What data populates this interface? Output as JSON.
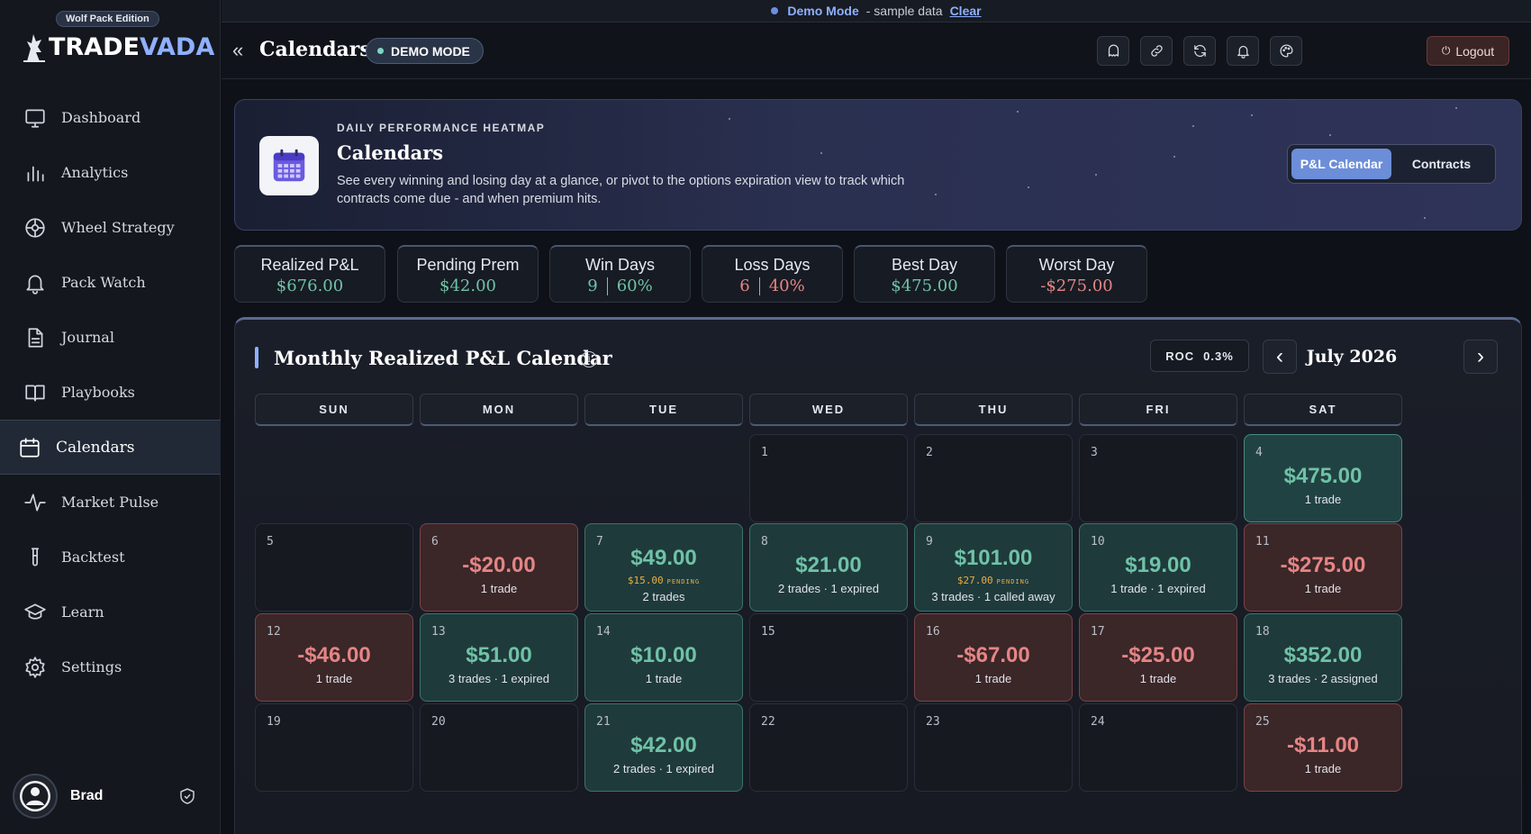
{
  "sidebar": {
    "edition": "Wolf Pack Edition",
    "brand_a": "TRADE",
    "brand_b": "VADA",
    "items": [
      {
        "label": "Dashboard",
        "icon": "monitor-icon"
      },
      {
        "label": "Analytics",
        "icon": "bar-chart-icon"
      },
      {
        "label": "Wheel Strategy",
        "icon": "wheel-icon"
      },
      {
        "label": "Pack Watch",
        "icon": "bell-icon"
      },
      {
        "label": "Journal",
        "icon": "document-icon"
      },
      {
        "label": "Playbooks",
        "icon": "book-icon"
      },
      {
        "label": "Calendars",
        "icon": "calendar-icon"
      },
      {
        "label": "Market Pulse",
        "icon": "pulse-icon"
      },
      {
        "label": "Backtest",
        "icon": "test-tube-icon"
      },
      {
        "label": "Learn",
        "icon": "graduation-cap-icon"
      },
      {
        "label": "Settings",
        "icon": "gear-icon"
      }
    ],
    "user": "Brad"
  },
  "demo_strip": {
    "mode": "Demo Mode",
    "sample": "- sample data",
    "clear": "Clear"
  },
  "header": {
    "title": "Calendars",
    "pill": "DEMO MODE",
    "logout": "Logout"
  },
  "hero": {
    "kicker": "DAILY PERFORMANCE HEATMAP",
    "title": "Calendars",
    "desc": "See every winning and losing day at a glance, or pivot to the options expiration view to track which contracts come due - and when premium hits.",
    "toggle": [
      "P&L Calendar",
      "Contracts"
    ]
  },
  "stats": [
    {
      "label": "Realized P&L",
      "value": "$676.00",
      "tone": "green"
    },
    {
      "label": "Pending Prem",
      "value": "$42.00",
      "tone": "green"
    },
    {
      "label": "Win Days",
      "count": "9",
      "pct": "60%",
      "tone": "green"
    },
    {
      "label": "Loss Days",
      "count": "6",
      "pct": "40%",
      "tone": "red"
    },
    {
      "label": "Best Day",
      "value": "$475.00",
      "tone": "green"
    },
    {
      "label": "Worst Day",
      "value": "-$275.00",
      "tone": "red"
    }
  ],
  "calendar": {
    "title": "Monthly Realized P&L Calendar",
    "roc_label": "ROC",
    "roc_value": "0.3%",
    "month": "July 2026",
    "weekdays": [
      "SUN",
      "MON",
      "TUE",
      "WED",
      "THU",
      "FRI",
      "SAT"
    ],
    "pending_tag": "PENDING",
    "days": [
      {
        "d": "1"
      },
      {
        "d": "2"
      },
      {
        "d": "3"
      },
      {
        "d": "4",
        "amt": "$475.00",
        "sub": "1 trade",
        "t": "win4"
      },
      {
        "d": "5"
      },
      {
        "d": "6",
        "amt": "-$20.00",
        "sub": "1 trade",
        "t": "loss"
      },
      {
        "d": "7",
        "amt": "$49.00",
        "pend": "$15.00",
        "sub": "2 trades",
        "t": "win"
      },
      {
        "d": "8",
        "amt": "$21.00",
        "sub": "2 trades · 1 expired",
        "t": "win"
      },
      {
        "d": "9",
        "amt": "$101.00",
        "pend": "$27.00",
        "sub": "3 trades · 1 called away",
        "t": "win"
      },
      {
        "d": "10",
        "amt": "$19.00",
        "sub": "1 trade · 1 expired",
        "t": "win"
      },
      {
        "d": "11",
        "amt": "-$275.00",
        "sub": "1 trade",
        "t": "loss"
      },
      {
        "d": "12",
        "amt": "-$46.00",
        "sub": "1 trade",
        "t": "loss"
      },
      {
        "d": "13",
        "amt": "$51.00",
        "sub": "3 trades · 1 expired",
        "t": "win"
      },
      {
        "d": "14",
        "amt": "$10.00",
        "sub": "1 trade",
        "t": "win"
      },
      {
        "d": "15"
      },
      {
        "d": "16",
        "amt": "-$67.00",
        "sub": "1 trade",
        "t": "loss"
      },
      {
        "d": "17",
        "amt": "-$25.00",
        "sub": "1 trade",
        "t": "loss"
      },
      {
        "d": "18",
        "amt": "$352.00",
        "sub": "3 trades · 2 assigned",
        "t": "win"
      },
      {
        "d": "19"
      },
      {
        "d": "20"
      },
      {
        "d": "21",
        "amt": "$42.00",
        "sub": "2 trades · 1 expired",
        "t": "win"
      },
      {
        "d": "22"
      },
      {
        "d": "23"
      },
      {
        "d": "24"
      },
      {
        "d": "25",
        "amt": "-$11.00",
        "sub": "1 trade",
        "t": "loss"
      }
    ]
  }
}
